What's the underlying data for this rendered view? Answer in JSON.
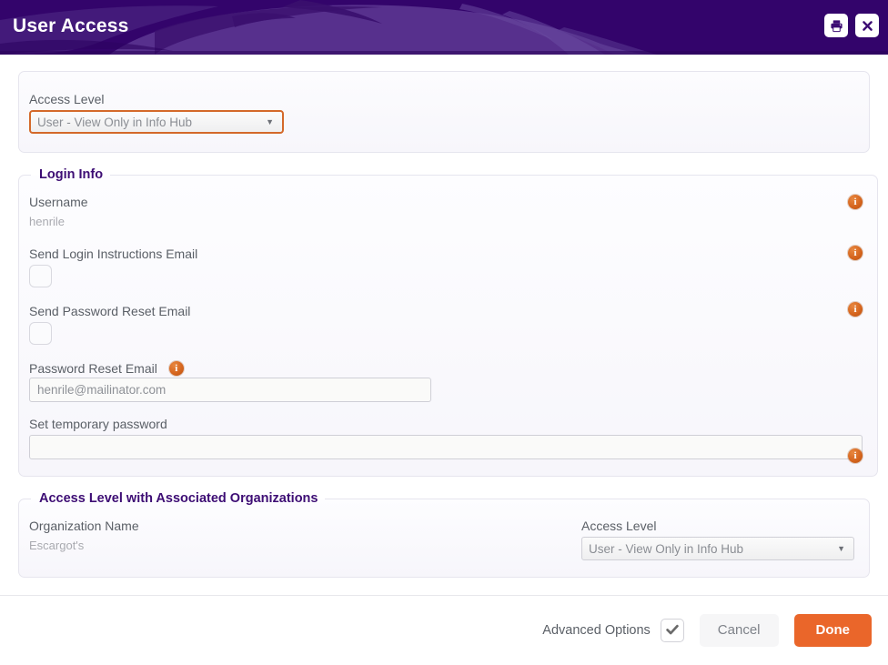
{
  "window": {
    "title": "User Access",
    "print_button_label": "Print",
    "close_button_label": "Close"
  },
  "access_level_panel": {
    "label": "Access Level",
    "selected": "User - View Only in Info Hub",
    "arrow": "▼"
  },
  "login_info": {
    "legend": "Login Info",
    "username_label": "Username",
    "username_value": "henrile",
    "send_login_instructions_label": "Send Login Instructions Email",
    "send_login_instructions_checked": false,
    "send_password_reset_label": "Send Password Reset Email",
    "send_password_reset_checked": false,
    "password_reset_email_label": "Password Reset Email",
    "password_reset_email_value": "henrile@mailinator.com",
    "set_temporary_password_label": "Set temporary password",
    "set_temporary_password_value": "",
    "info_icon_glyph": "i"
  },
  "associated_orgs": {
    "legend": "Access Level with Associated Organizations",
    "org_name_label": "Organization Name",
    "org_name_value": "Escargot's",
    "access_level_label": "Access Level",
    "access_level_selected": "User - View Only in Info Hub",
    "arrow": "▼"
  },
  "footer": {
    "advanced_options_label": "Advanced Options",
    "advanced_options_checked": true,
    "check_glyph": "✔",
    "cancel_label": "Cancel",
    "done_label": "Done"
  },
  "colors": {
    "header_purple": "#33046b",
    "legend_purple": "#3d0d74",
    "accent_orange": "#ea662a",
    "focus_orange": "#d4692a",
    "info_orange": "#d4631c"
  }
}
